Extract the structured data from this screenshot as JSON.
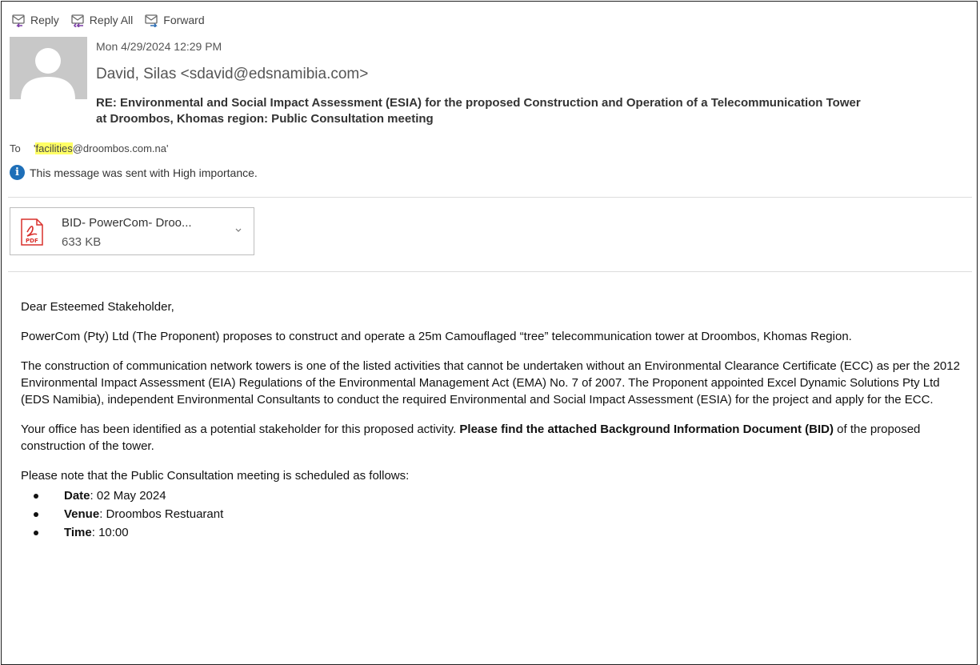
{
  "toolbar": {
    "reply_label": "Reply",
    "reply_all_label": "Reply All",
    "forward_label": "Forward"
  },
  "header": {
    "date": "Mon 4/29/2024 12:29 PM",
    "sender": "David, Silas <sdavid@edsnamibia.com>",
    "subject_line1": "RE: Environmental and Social Impact Assessment (ESIA) for the proposed Construction and Operation of a Telecommunication Tower",
    "subject_line2": "at Droombos, Khomas region: Public Consultation meeting",
    "to_label": "To",
    "to_quote_open": "'",
    "to_highlight": "facilities",
    "to_rest": "@droombos.com.na'",
    "importance": "This message was sent with High importance."
  },
  "attachment": {
    "name": "BID- PowerCom- Droo...",
    "size": "633 KB"
  },
  "body": {
    "greeting": "Dear Esteemed Stakeholder,",
    "para1": "PowerCom (Pty) Ltd (The Proponent) proposes to construct and operate a 25m Camouflaged “tree” telecommunication tower at Droombos, Khomas Region.",
    "para2": "The construction of communication network towers is one of the listed activities that cannot be undertaken without an Environmental Clearance Certificate (ECC) as per the 2012 Environmental Impact Assessment (EIA) Regulations of the Environmental Management Act (EMA) No. 7 of 2007. The Proponent appointed Excel Dynamic Solutions Pty Ltd (EDS Namibia), independent Environmental Consultants to conduct the required Environmental and Social Impact Assessment (ESIA) for the project and apply for the ECC.",
    "para3_plain": "Your office has been identified as a potential stakeholder for this proposed activity. ",
    "para3_bold": "Please find the attached Background Information Document (BID)",
    "para3_tail": " of the proposed construction of the tower.",
    "schedule_intro": "Please note that the Public Consultation meeting is scheduled as follows:",
    "items": [
      {
        "label": "Date",
        "value": ": 02 May 2024"
      },
      {
        "label": "Venue",
        "value": ": Droombos Restuarant"
      },
      {
        "label": "Time",
        "value": ": 10:00"
      }
    ]
  },
  "colors": {
    "highlight": "#ffff66",
    "info_icon": "#1e6fb8",
    "pdf_red": "#d9302c"
  }
}
